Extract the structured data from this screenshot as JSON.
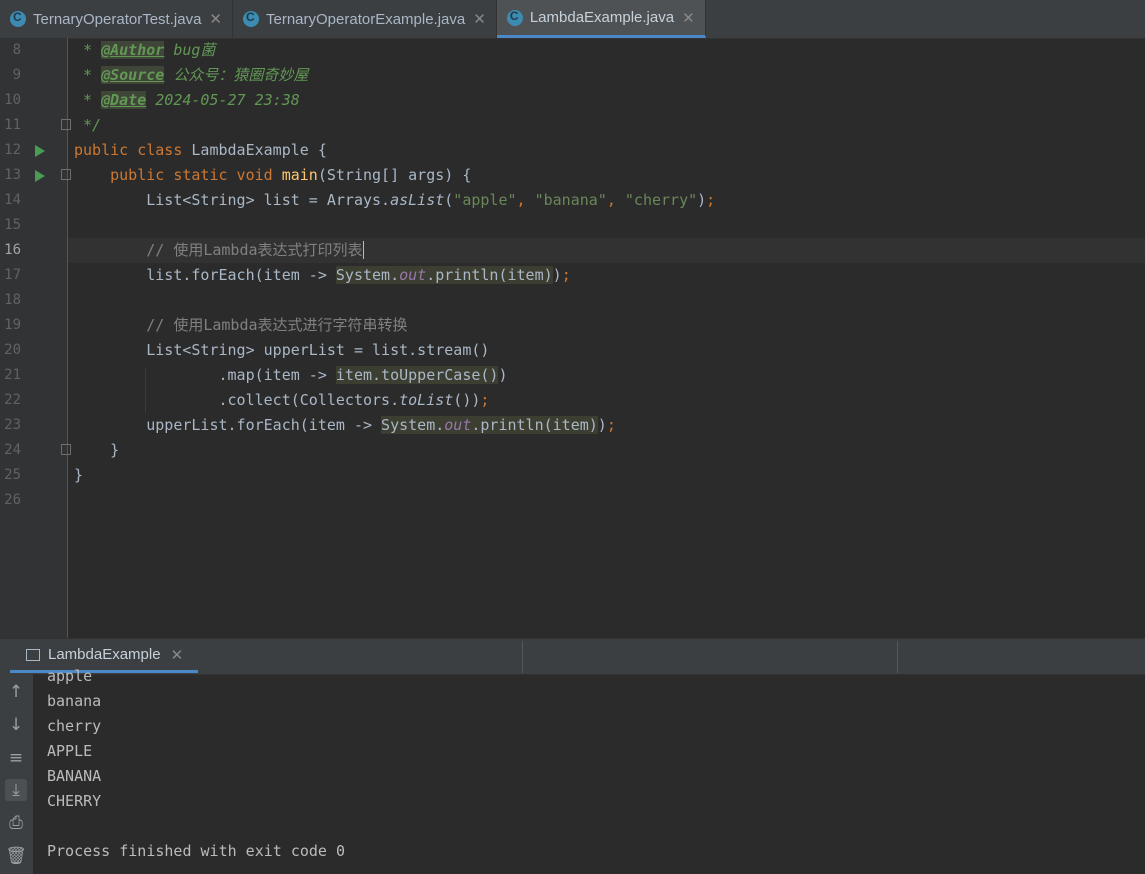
{
  "tabs": [
    {
      "label": "TernaryOperatorTest.java",
      "active": false
    },
    {
      "label": "TernaryOperatorExample.java",
      "active": false
    },
    {
      "label": "LambdaExample.java",
      "active": true
    }
  ],
  "editor": {
    "current_line": "16",
    "line_numbers": [
      "8",
      "9",
      "10",
      "11",
      "12",
      "13",
      "14",
      "15",
      "16",
      "17",
      "18",
      "19",
      "20",
      "21",
      "22",
      "23",
      "24",
      "25",
      "26"
    ],
    "author_tag": "@Author",
    "author_val": "bug菌",
    "source_tag": "@Source",
    "source_val": "公众号：猿圈奇妙屋",
    "date_tag": "@Date",
    "date_val": "2024-05-27 23:38",
    "comment_end": "*/",
    "class_name": "LambdaExample",
    "main_name": "main",
    "strings": [
      "\"apple\"",
      "\"banana\"",
      "\"cherry\""
    ],
    "comment1": "// 使用Lambda表达式打印列表",
    "comment2": "// 使用Lambda表达式进行字符串转换"
  },
  "run": {
    "tab_label": "LambdaExample",
    "output": [
      "apple",
      "banana",
      "cherry",
      "APPLE",
      "BANANA",
      "CHERRY",
      "",
      "Process finished with exit code 0"
    ]
  },
  "icons": {
    "tab_file": "java-class-icon",
    "run_gutter": "run-arrow-icon",
    "sidebar": [
      "up-arrow-icon",
      "down-arrow-icon",
      "soft-wrap-icon",
      "scroll-to-end-icon",
      "print-icon",
      "trash-icon"
    ]
  },
  "colors": {
    "keyword": "#cc7832",
    "string": "#6a8759",
    "doc": "#629755",
    "method": "#ffc66d",
    "field": "#9876aa",
    "accent": "#4a88c7"
  }
}
